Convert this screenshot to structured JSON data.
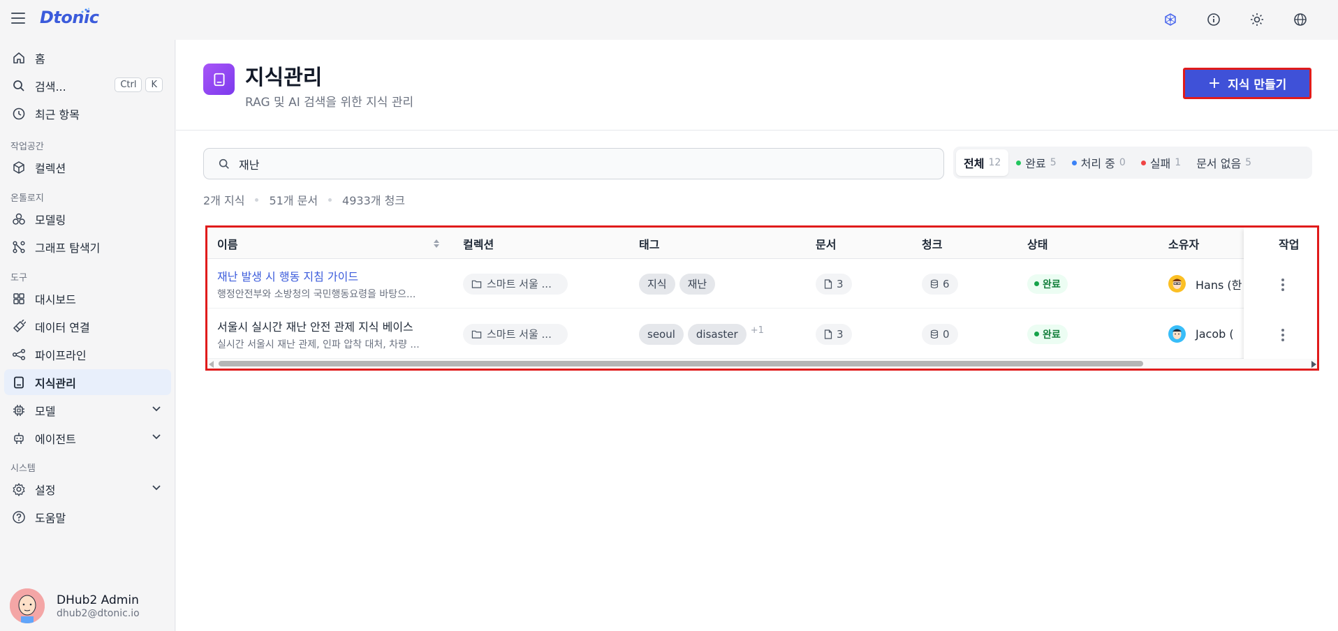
{
  "app": {
    "logo": "Dtonic"
  },
  "topbar": {
    "icons": [
      "network-icon",
      "info-icon",
      "sun-icon",
      "globe-icon"
    ]
  },
  "sidebar": {
    "home": "홈",
    "search": "검색...",
    "search_kbd": [
      "Ctrl",
      "K"
    ],
    "recent": "최근 항목",
    "section_workspace": "작업공간",
    "collection": "컬렉션",
    "section_ontology": "온톨로지",
    "modeling": "모델링",
    "graph_explorer": "그래프 탐색기",
    "section_tools": "도구",
    "dashboard": "대시보드",
    "data_connection": "데이터 연결",
    "pipeline": "파이프라인",
    "knowledge": "지식관리",
    "model": "모델",
    "agent": "에이전트",
    "section_system": "시스템",
    "settings": "설정",
    "help": "도움말"
  },
  "user": {
    "name": "DHub2 Admin",
    "email": "dhub2@dtonic.io"
  },
  "header": {
    "title": "지식관리",
    "subtitle": "RAG 및 AI 검색을 위한 지식 관리",
    "create_button": "지식 만들기"
  },
  "search": {
    "value": "재난"
  },
  "filters": [
    {
      "label": "전체",
      "count": "12"
    },
    {
      "label": "완료",
      "count": "5",
      "color": "#22c55e"
    },
    {
      "label": "처리 중",
      "count": "0",
      "color": "#3b82f6"
    },
    {
      "label": "실패",
      "count": "1",
      "color": "#ef4444"
    },
    {
      "label": "문서 없음",
      "count": "5"
    }
  ],
  "stats": {
    "knowledge": "2개 지식",
    "documents": "51개 문서",
    "chunks": "4933개 청크"
  },
  "table": {
    "columns": [
      "이름",
      "컬렉션",
      "태그",
      "문서",
      "청크",
      "상태",
      "소유자",
      "작업"
    ],
    "rows": [
      {
        "name": "재난 발생 시 행동 지침 가이드",
        "description": "행정안전부와 소방청의 국민행동요령을 바탕으...",
        "collection": "스마트 서울 ...",
        "tags": [
          "지식",
          "재난"
        ],
        "more_tags": "",
        "documents": "3",
        "chunks": "6",
        "status": "완료",
        "owner": "Hans (한"
      },
      {
        "name": "서울시 실시간 재난 안전 관제 지식 베이스",
        "description": "실시간 서울시 재난 관제, 인파 압착 대처, 차량 ...",
        "collection": "스마트 서울 ...",
        "tags": [
          "seoul",
          "disaster"
        ],
        "more_tags": "+1",
        "documents": "3",
        "chunks": "0",
        "status": "완료",
        "owner": "Jacob (",
        "_unused": null
      }
    ]
  },
  "colors": {
    "accent": "#3f51d8",
    "link": "#3b5bdb",
    "success": "#16a34a"
  }
}
